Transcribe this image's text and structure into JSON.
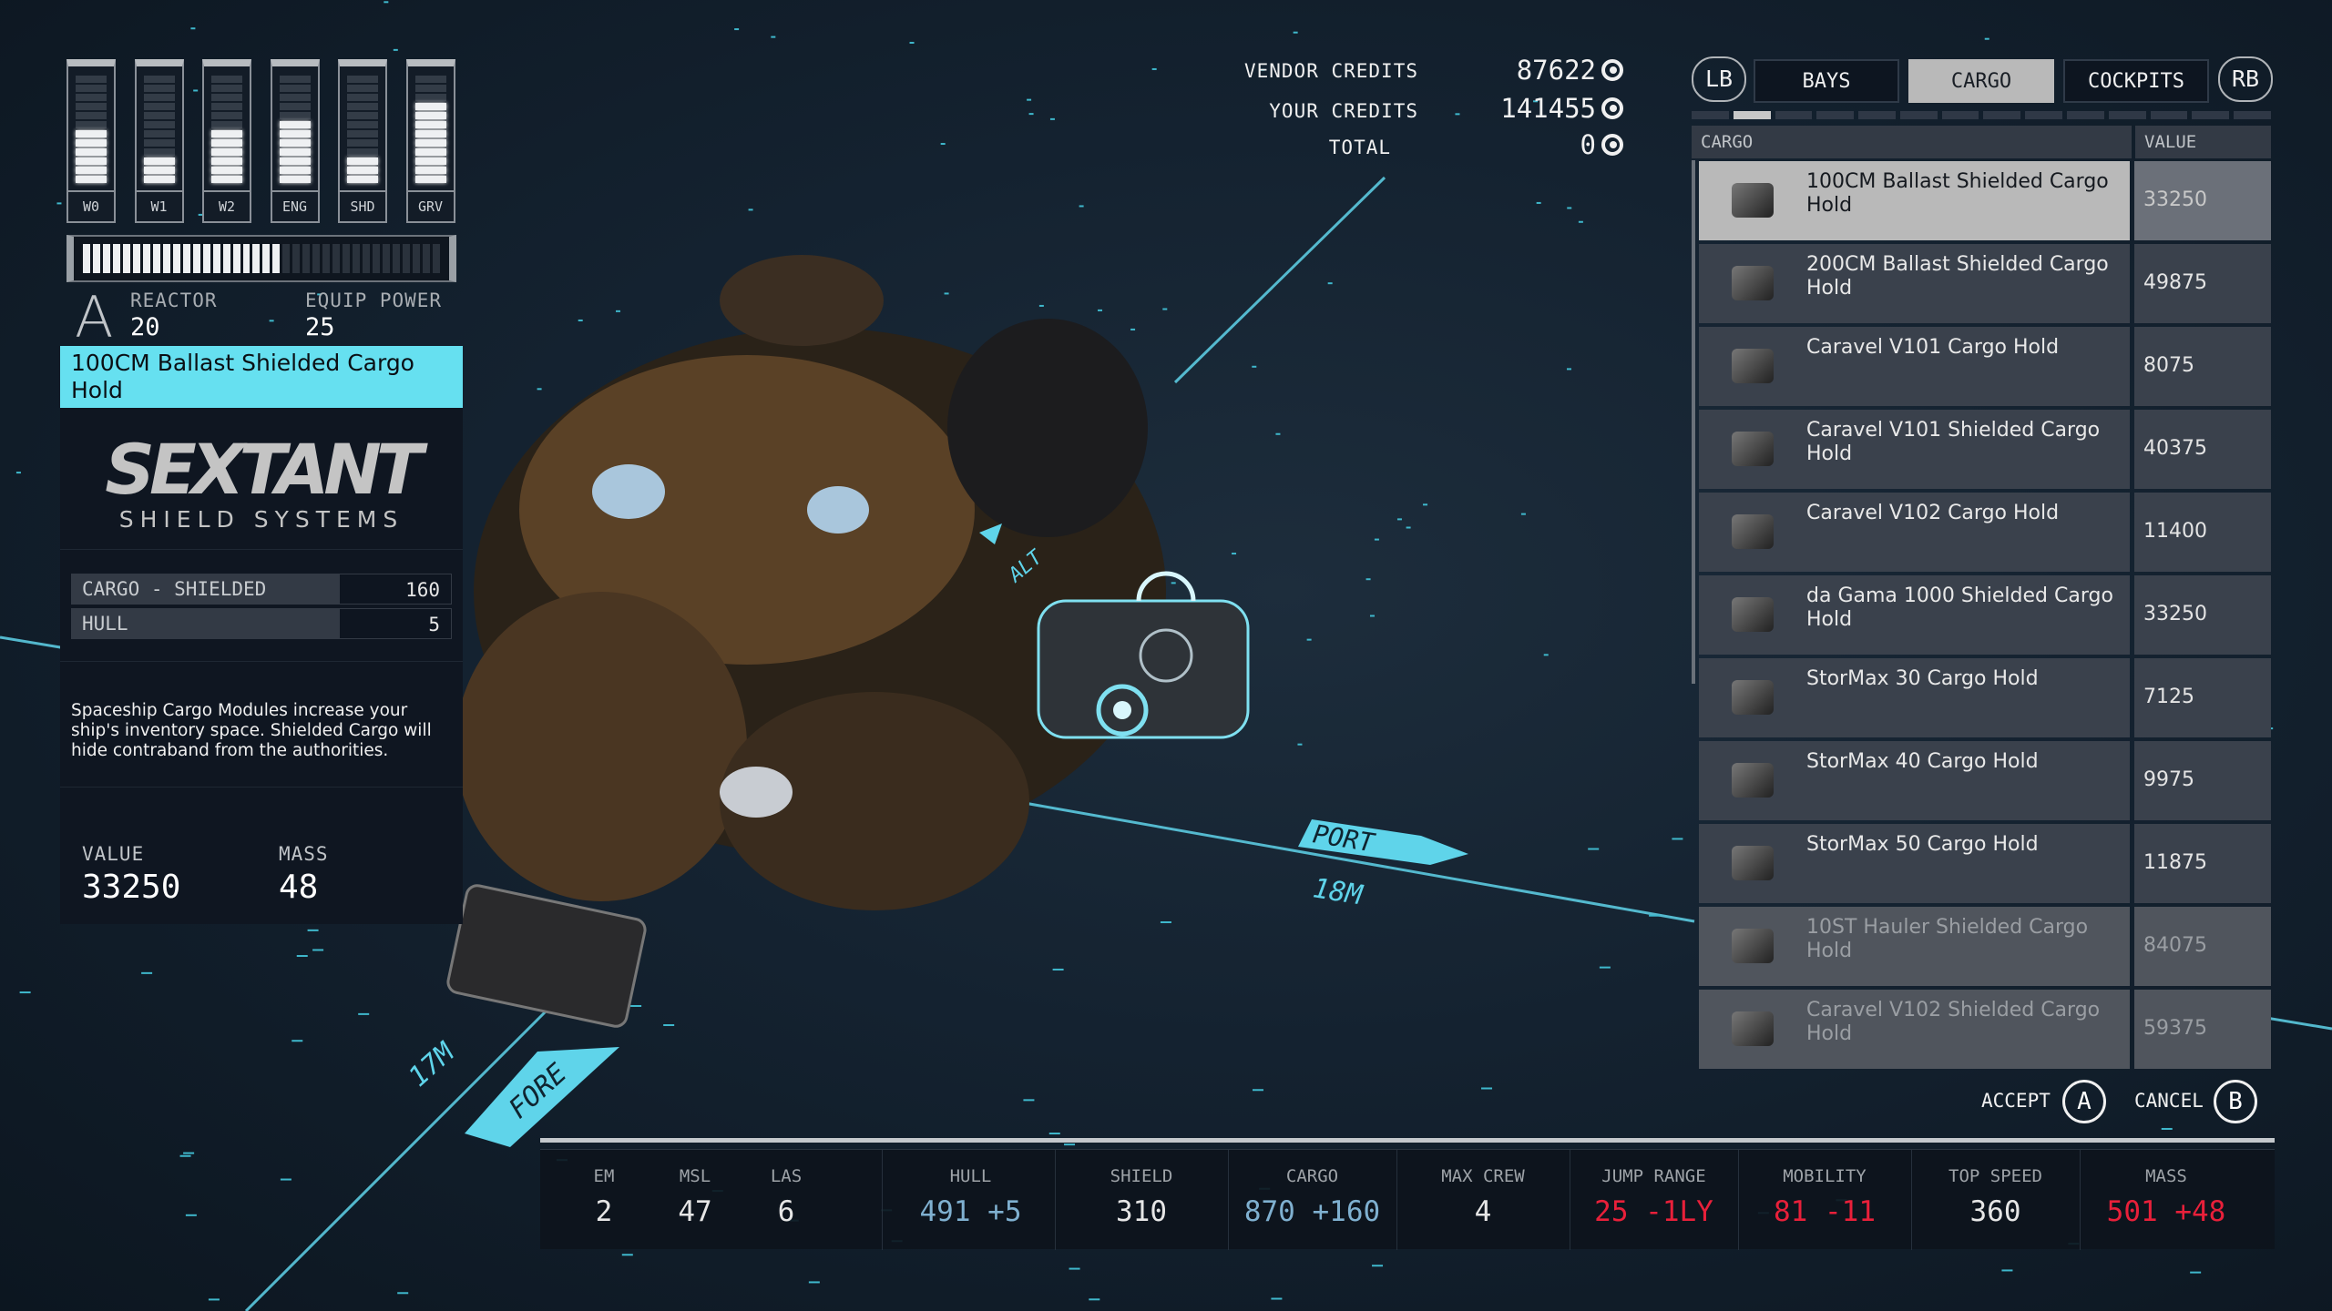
{
  "colors": {
    "accent": "#66e0f0",
    "positive": "#7fb0d0",
    "negative": "#e8203a",
    "background": "#142230"
  },
  "power": {
    "bars": [
      {
        "label": "W0",
        "level": 6,
        "max": 12
      },
      {
        "label": "W1",
        "level": 3,
        "max": 12
      },
      {
        "label": "W2",
        "level": 6,
        "max": 12
      },
      {
        "label": "ENG",
        "level": 7,
        "max": 12
      },
      {
        "label": "SHD",
        "level": 3,
        "max": 12
      },
      {
        "label": "GRV",
        "level": 9,
        "max": 12
      }
    ],
    "reactor_level": 20,
    "reactor_max": 36,
    "reactor_class_icon": "A",
    "reactor_label": "REACTOR",
    "reactor_value": "20",
    "equip_label": "EQUIP POWER",
    "equip_value": "25"
  },
  "selected": {
    "title": "100CM Ballast Shielded Cargo Hold",
    "brand": "SEXTANT",
    "brand_sub": "SHIELD SYSTEMS",
    "stats": [
      {
        "name": "CARGO - SHIELDED",
        "value": "160"
      },
      {
        "name": "HULL",
        "value": "5"
      }
    ],
    "description": "Spaceship Cargo Modules increase your ship's inventory space. Shielded Cargo will hide contraband from the authorities.",
    "value_label": "VALUE",
    "value": "33250",
    "mass_label": "MASS",
    "mass": "48"
  },
  "credits": {
    "vendor_label": "VENDOR CREDITS",
    "vendor": "87622",
    "yours_label": "YOUR CREDITS",
    "yours": "141455",
    "total_label": "TOTAL",
    "total": "0",
    "icon": "credits-icon"
  },
  "tabs": {
    "lb": "LB",
    "rb": "RB",
    "items": [
      {
        "label": "BAYS",
        "active": false
      },
      {
        "label": "CARGO",
        "active": true
      },
      {
        "label": "COCKPITS",
        "active": false
      }
    ],
    "pages": 14,
    "active_page": 1
  },
  "table": {
    "headers": [
      "CARGO",
      "VALUE"
    ],
    "rows": [
      {
        "name": "100CM Ballast Shielded Cargo Hold",
        "value": "33250",
        "state": "selected"
      },
      {
        "name": "200CM Ballast Shielded Cargo Hold",
        "value": "49875",
        "state": "normal"
      },
      {
        "name": "Caravel V101 Cargo Hold",
        "value": "8075",
        "state": "normal"
      },
      {
        "name": "Caravel V101 Shielded Cargo Hold",
        "value": "40375",
        "state": "normal"
      },
      {
        "name": "Caravel V102 Cargo Hold",
        "value": "11400",
        "state": "normal"
      },
      {
        "name": "da Gama 1000 Shielded Cargo Hold",
        "value": "33250",
        "state": "normal"
      },
      {
        "name": "StorMax 30 Cargo Hold",
        "value": "7125",
        "state": "normal"
      },
      {
        "name": "StorMax 40 Cargo Hold",
        "value": "9975",
        "state": "normal"
      },
      {
        "name": "StorMax 50 Cargo Hold",
        "value": "11875",
        "state": "normal"
      },
      {
        "name": "10ST Hauler Shielded Cargo Hold",
        "value": "84075",
        "state": "disabled"
      },
      {
        "name": "Caravel V102 Shielded Cargo Hold",
        "value": "59375",
        "state": "disabled"
      }
    ]
  },
  "actions": {
    "accept": "ACCEPT",
    "accept_key": "A",
    "cancel": "CANCEL",
    "cancel_key": "B"
  },
  "viewport": {
    "port": "PORT",
    "port_dist": "18M",
    "fore": "FORE",
    "fore_dist": "17M",
    "alt": "ALT"
  },
  "ship_stats": [
    {
      "label": "EM",
      "value": "2",
      "tone": "normal"
    },
    {
      "label": "MSL",
      "value": "47",
      "tone": "normal"
    },
    {
      "label": "LAS",
      "value": "6",
      "tone": "normal"
    },
    {
      "label": "HULL",
      "value": "491 +5",
      "tone": "positive"
    },
    {
      "label": "SHIELD",
      "value": "310",
      "tone": "normal"
    },
    {
      "label": "CARGO",
      "value": "870 +160",
      "tone": "positive"
    },
    {
      "label": "MAX CREW",
      "value": "4",
      "tone": "normal"
    },
    {
      "label": "JUMP RANGE",
      "value": "25 -1LY",
      "tone": "negative"
    },
    {
      "label": "MOBILITY",
      "value": "81 -11",
      "tone": "negative"
    },
    {
      "label": "TOP SPEED",
      "value": "360",
      "tone": "normal"
    },
    {
      "label": "MASS",
      "value": "501 +48",
      "tone": "negative"
    }
  ]
}
